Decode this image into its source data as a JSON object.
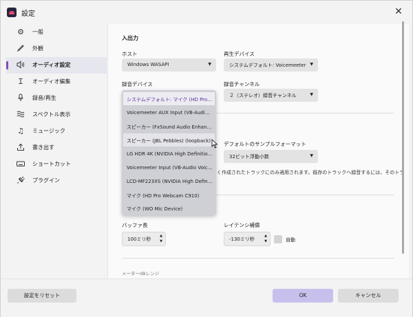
{
  "window": {
    "title": "設定"
  },
  "sidebar": {
    "items": [
      {
        "label": "一般",
        "icon": "gear-icon"
      },
      {
        "label": "外観",
        "icon": "brush-icon"
      },
      {
        "label": "オーディオ設定",
        "icon": "speaker-icon",
        "active": true
      },
      {
        "label": "オーディオ編集",
        "icon": "cursor-text-icon"
      },
      {
        "label": "録音/再生",
        "icon": "microphone-icon"
      },
      {
        "label": "スペクトル表示",
        "icon": "spectrum-icon"
      },
      {
        "label": "ミュージック",
        "icon": "music-note-icon"
      },
      {
        "label": "書き出す",
        "icon": "export-icon"
      },
      {
        "label": "ショートカット",
        "icon": "keyboard-icon"
      },
      {
        "label": "プラグイン",
        "icon": "plugin-icon"
      }
    ]
  },
  "io": {
    "heading": "入出力",
    "host_label": "ホスト",
    "host_value": "Windows WASAPI",
    "playback_label": "再生デバイス",
    "playback_value": "システムデフォルト: Voicemeeter ...",
    "record_label": "録音デバイス",
    "record_channel_label": "録音チャンネル",
    "record_channel_value": "２（ステレオ）録音チャンネル"
  },
  "dropdown": {
    "options": [
      "システムデフォルト: マイク (HD Pro Web...",
      "Voicemeeter AUX Input (VB-Audio ...",
      "スピーカー (FxSound Audio Enhancer)...",
      "スピーカー (JBL Pebbles) (loopback)",
      "LG HDR 4K (NVIDIA High Definition...",
      "Voicemeeter Input (VB-Audio Voice...",
      "LCD-MF223XS (NVIDIA High Defini...",
      "マイク (HD Pro Webcam C910)",
      "マイク (WO Mic Device)"
    ],
    "selected_index": 0,
    "hover_index": 3
  },
  "sample_format": {
    "label": "デフォルトのサンプルフォーマット",
    "value": "32ビット浮動小数"
  },
  "note_text": "く作成されたトラックにのみ適用されます。既存のトラックへ録音するには、そのトラ",
  "latency": {
    "buffer_label": "バッファ長",
    "buffer_value": "100ミリ秒",
    "comp_label": "レイテンシ補償",
    "comp_value": "-130ミリ秒",
    "auto_label": "自動"
  },
  "meter_label": "メーターdBレンジ",
  "footer": {
    "reset_label": "設定をリセット",
    "ok_label": "OK",
    "cancel_label": "キャンセル"
  },
  "colors": {
    "accent": "#7b4fb0",
    "ok_button": "#c8c0ec"
  }
}
